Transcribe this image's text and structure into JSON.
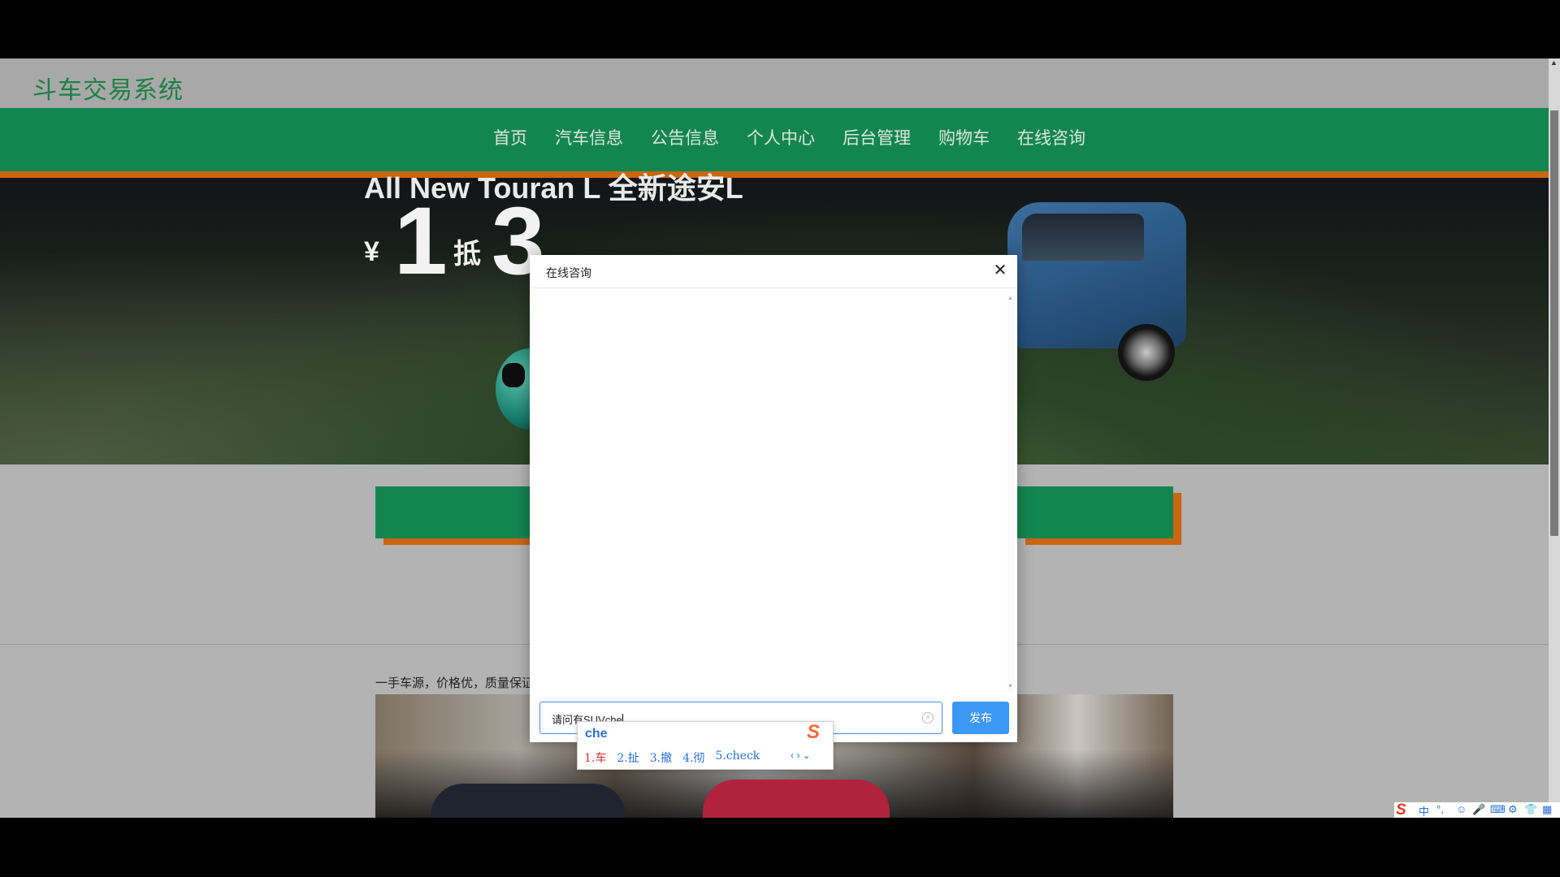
{
  "site": {
    "title": "斗车交易系统"
  },
  "nav": {
    "items": [
      "首页",
      "汽车信息",
      "公告信息",
      "个人中心",
      "后台管理",
      "购物车",
      "在线咨询"
    ]
  },
  "banner": {
    "headline_small": "All New Touran L 全新途安L",
    "yen": "¥",
    "amount": "1",
    "deduct": "抵",
    "amount2": "3"
  },
  "section": {
    "caption": "一手车源，价格优，质量保证"
  },
  "modal": {
    "title": "在线咨询",
    "close_icon": "close-icon",
    "input_value": "请问有SUVche",
    "send_label": "发布"
  },
  "ime": {
    "composition": "che",
    "candidates": [
      "1.车",
      "2.扯",
      "3.撤",
      "4.彻",
      "5.check"
    ],
    "nav": "‹ › ⌄"
  },
  "tray": {
    "items": [
      "中",
      "°,",
      "☺",
      "🎤",
      "⌨",
      "⚙",
      "👕",
      "▦"
    ]
  },
  "colors": {
    "brand_green": "#138650",
    "accent_orange": "#c9660f",
    "send_blue": "#3d97f5"
  }
}
